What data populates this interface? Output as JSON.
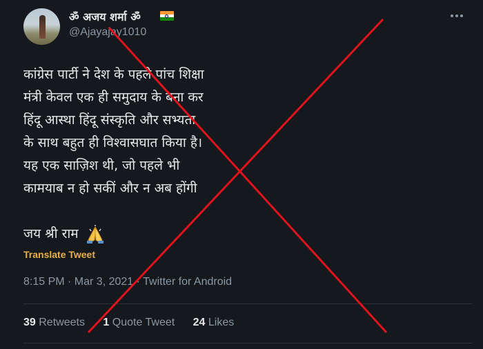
{
  "tweet": {
    "author_name": "ॐ अजय शर्मा ॐ",
    "handle": "@Ajayajay1010",
    "more_icon": "more-icon",
    "text_lines": [
      "कांग्रेस पार्टी ने देश के पहले पांच शिक्षा",
      "मंत्री केवल एक ही समुदाय के बना कर",
      "हिंदू आस्था हिंदू संस्कृति और सभ्यता",
      "के साथ बहुत ही विश्वासघात किया है।",
      "यह एक साज़िश थी, जो पहले भी",
      "कामयाब न हो सकीं और न अब होंगी"
    ],
    "closing_line": "जय श्री राम",
    "emoji": "folded-hands-emoji",
    "translate_label": "Translate Tweet",
    "timestamp": "8:15 PM · Mar 3, 2021 · Twitter for Android",
    "stats": {
      "retweets_count": "39",
      "retweets_label": "Retweets",
      "quote_count": "1",
      "quote_label": "Quote Tweet",
      "likes_count": "24",
      "likes_label": "Likes"
    }
  },
  "colors": {
    "background": "#15181c",
    "translate_link": "#e8b04a",
    "cross_overlay": "#e0141e"
  }
}
